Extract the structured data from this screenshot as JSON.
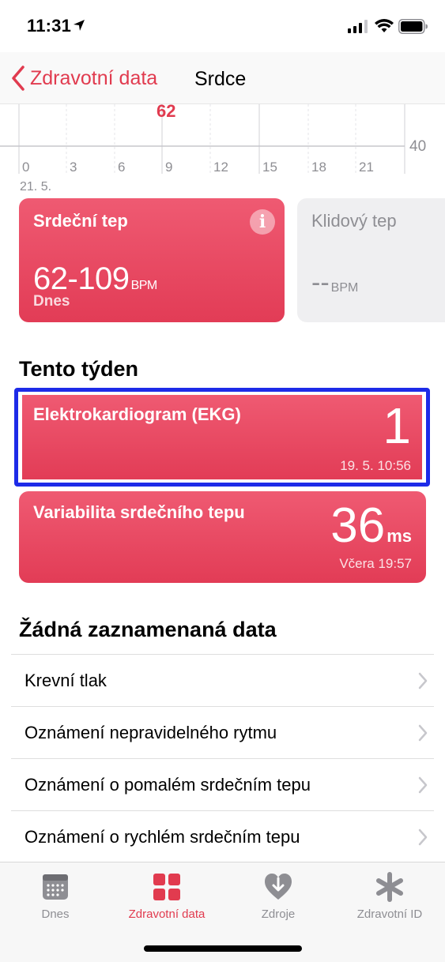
{
  "status_bar": {
    "time": "11:31"
  },
  "nav": {
    "back_label": "Zdravotní data",
    "title": "Srdce"
  },
  "chart": {
    "peak_label": "62",
    "x_ticks": [
      "0",
      "3",
      "6",
      "9",
      "12",
      "15",
      "18",
      "21"
    ],
    "y_label": "40",
    "date": "21. 5."
  },
  "heart_rate": {
    "title": "Srdeční tep",
    "info": "i",
    "value": "62-109",
    "unit": "BPM",
    "sub": "Dnes"
  },
  "resting": {
    "title": "Klidový tep",
    "value": "--",
    "unit": "BPM"
  },
  "this_week": {
    "heading": "Tento týden"
  },
  "ekg": {
    "title": "Elektrokardiogram (EKG)",
    "value": "1",
    "date": "19. 5. 10:56"
  },
  "hrv": {
    "title": "Variabilita srdečního tepu",
    "value": "36",
    "unit": "ms",
    "date": "Včera 19:57"
  },
  "no_data": {
    "heading": "Žádná zaznamenaná data",
    "items": [
      {
        "label": "Krevní tlak"
      },
      {
        "label": "Oznámení nepravidelného rytmu"
      },
      {
        "label": "Oznámení o pomalém srdečním tepu"
      },
      {
        "label": "Oznámení o rychlém srdečním tepu"
      }
    ]
  },
  "tabs": [
    {
      "label": "Dnes",
      "icon": "calendar-icon"
    },
    {
      "label": "Zdravotní data",
      "icon": "grid-icon"
    },
    {
      "label": "Zdroje",
      "icon": "heart-download-icon"
    },
    {
      "label": "Zdravotní ID",
      "icon": "asterisk-icon"
    }
  ],
  "colors": {
    "accent": "#e13b4f",
    "card_red": "#e8485f",
    "highlight": "#1d2be8"
  }
}
